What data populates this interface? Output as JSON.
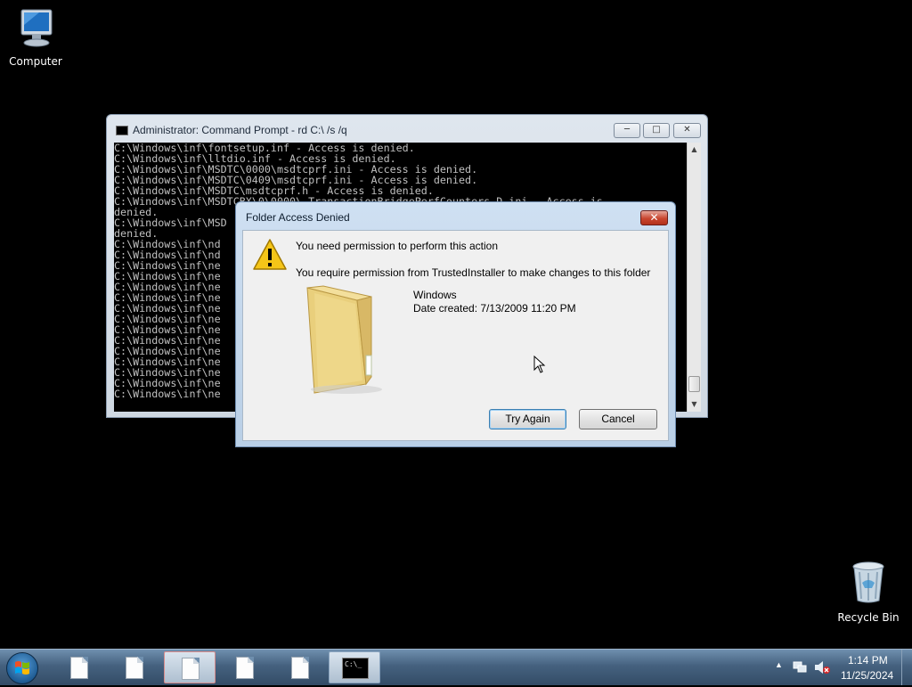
{
  "desktop": {
    "computer_label": "Computer",
    "recycle_label": "Recycle Bin"
  },
  "cmd_window": {
    "title": "Administrator:  Command Prompt - rd  C:\\ /s /q",
    "lines": [
      "C:\\Windows\\inf\\fontsetup.inf - Access is denied.",
      "C:\\Windows\\inf\\lltdio.inf - Access is denied.",
      "C:\\Windows\\inf\\MSDTC\\0000\\msdtcprf.ini - Access is denied.",
      "C:\\Windows\\inf\\MSDTC\\0409\\msdtcprf.ini - Access is denied.",
      "C:\\Windows\\inf\\MSDTC\\msdtcprf.h - Access is denied.",
      "C:\\Windows\\inf\\MSDTCBX\\0\\0000\\ TransactionBridgePerfCounters_D.ini - Access is",
      "denied.",
      "C:\\Windows\\inf\\MSD",
      "denied.",
      "C:\\Windows\\inf\\nd",
      "C:\\Windows\\inf\\nd",
      "C:\\Windows\\inf\\ne",
      "C:\\Windows\\inf\\ne",
      "C:\\Windows\\inf\\ne",
      "C:\\Windows\\inf\\ne",
      "C:\\Windows\\inf\\ne",
      "C:\\Windows\\inf\\ne",
      "C:\\Windows\\inf\\ne",
      "C:\\Windows\\inf\\ne",
      "C:\\Windows\\inf\\ne",
      "C:\\Windows\\inf\\ne",
      "C:\\Windows\\inf\\ne",
      "C:\\Windows\\inf\\ne",
      "C:\\Windows\\inf\\ne"
    ]
  },
  "dialog": {
    "title": "Folder Access Denied",
    "heading": "You need permission to perform this action",
    "message": "You require permission from TrustedInstaller to make changes to this folder",
    "folder_name": "Windows",
    "date_created": "Date created: 7/13/2009 11:20 PM",
    "try_again_label": "Try Again",
    "cancel_label": "Cancel"
  },
  "taskbar": {
    "time": "1:14 PM",
    "date": "11/25/2024",
    "cmd_icon_text": "C:\\_"
  }
}
